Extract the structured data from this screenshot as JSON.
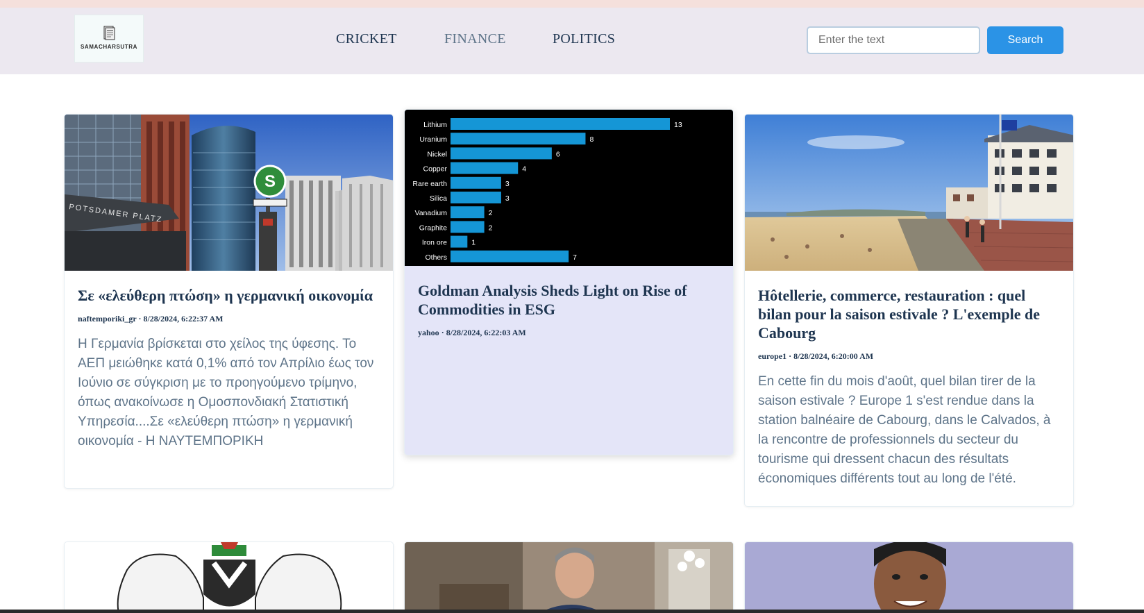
{
  "brand": {
    "name": "SAMACHARSUTRA"
  },
  "nav": {
    "links": [
      "CRICKET",
      "FINANCE",
      "POLITICS"
    ]
  },
  "search": {
    "placeholder": "Enter the text",
    "button_label": "Search"
  },
  "colors": {
    "nav_bg": "#ece8f0",
    "accent": "#2b93e6",
    "title": "#1e3550",
    "muted": "#5e7489",
    "highlight_card": "#e4e5f8"
  },
  "cards": [
    {
      "title": "Σε «ελεύθερη πτώση» η γερμανική οικονομία",
      "source": "naftemporiki_gr",
      "date": "8/28/2024, 6:22:37 AM",
      "description": "Η Γερμανία βρίσκεται στο χείλος της ύφεσης. Το ΑΕΠ μειώθηκε κατά 0,1% από τον Απρίλιο έως τον Ιούνιο σε σύγκριση με το προηγούμενο τρίμηνο, όπως ανακοίνωσε η Ομοσπονδιακή Στατιστική Υπηρεσία....Σε «ελεύθερη πτώση» η γερμανική οικονομία - Η ΝΑΥΤΕΜΠΟΡΙΚΗ",
      "image": {
        "sign_text": "POTSDAMER PLATZ",
        "sbahn": "S"
      }
    },
    {
      "title": "Goldman Analysis Sheds Light on Rise of Commodities in ESG",
      "source": "yahoo",
      "date": "8/28/2024, 6:22:03 AM",
      "description": ""
    },
    {
      "title": "Hôtellerie, commerce, restauration : quel bilan pour la saison estivale ? L'exemple de Cabourg",
      "source": "europe1",
      "date": "8/28/2024, 6:20:00 AM",
      "description": "En cette fin du mois d'août, quel bilan tirer de la saison estivale ? Europe 1 s'est rendue dans la station balnéaire de Cabourg, dans le Calvados, à la rencontre de professionnels du secteur du tourisme qui dressent chacun des résultats économiques différents tout au long de l'été."
    }
  ],
  "chart_data": {
    "type": "bar",
    "orientation": "horizontal",
    "categories": [
      "Lithium",
      "Uranium",
      "Nickel",
      "Copper",
      "Rare earth",
      "Silica",
      "Vanadium",
      "Graphite",
      "Iron ore",
      "Others"
    ],
    "values": [
      13,
      8,
      6,
      4,
      3,
      3,
      2,
      2,
      1,
      7
    ],
    "xlim": [
      0,
      13
    ],
    "bar_color": "#1596d6",
    "background": "#000000",
    "title": "",
    "xlabel": "",
    "ylabel": ""
  }
}
